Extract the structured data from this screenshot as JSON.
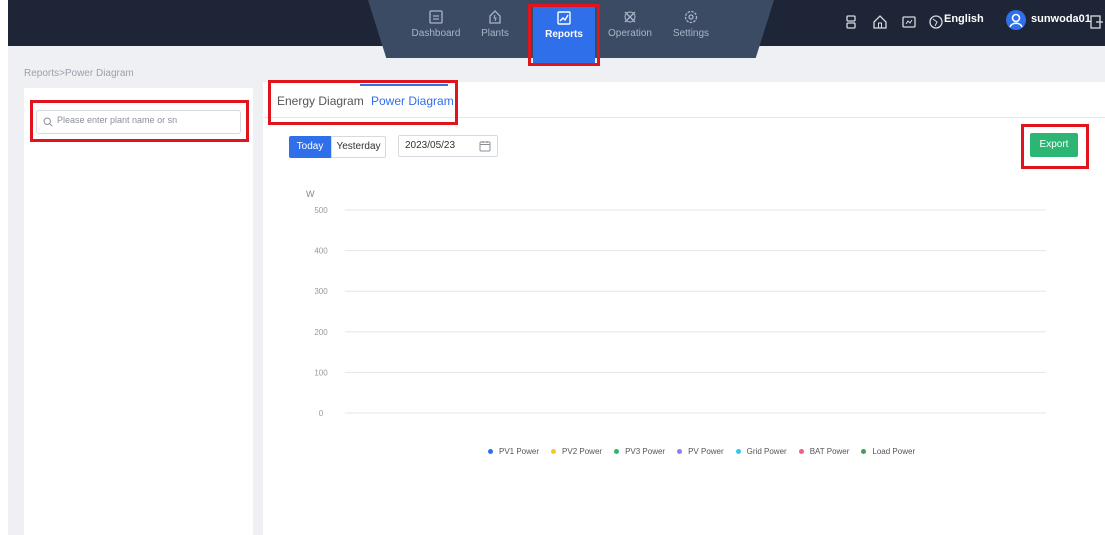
{
  "nav": {
    "items": [
      {
        "label": "Dashboard",
        "icon": "dashboard-icon",
        "active": false
      },
      {
        "label": "Plants",
        "icon": "plants-icon",
        "active": false
      },
      {
        "label": "Reports",
        "icon": "reports-icon",
        "active": true
      },
      {
        "label": "Operation",
        "icon": "operation-icon",
        "active": false
      },
      {
        "label": "Settings",
        "icon": "settings-icon",
        "active": false
      }
    ],
    "language": "English",
    "username": "sunwoda01"
  },
  "breadcrumb": "Reports>Power Diagram",
  "search": {
    "placeholder": "Please enter plant name or sn"
  },
  "tabs": [
    {
      "label": "Energy Diagram",
      "active": false
    },
    {
      "label": "Power Diagram",
      "active": true
    }
  ],
  "toolbar": {
    "today_label": "Today",
    "yesterday_label": "Yesterday",
    "date_value": "2023/05/23",
    "export_label": "Export"
  },
  "colors": {
    "accent": "#2f6fea",
    "export": "#2bb673",
    "highlight": "#e0141c",
    "topbar": "#1d2536"
  },
  "chart_data": {
    "type": "line",
    "ylabel": "W",
    "ylim": [
      0,
      500
    ],
    "yticks": [
      500,
      400,
      300,
      200,
      100,
      0
    ],
    "grid": true,
    "legend_position": "bottom",
    "series": [
      {
        "name": "PV1 Power",
        "color": "#2f6fea",
        "values": []
      },
      {
        "name": "PV2 Power",
        "color": "#f7c823",
        "values": []
      },
      {
        "name": "PV3 Power",
        "color": "#2bb673",
        "values": []
      },
      {
        "name": "PV Power",
        "color": "#8d7ff0",
        "values": []
      },
      {
        "name": "Grid Power",
        "color": "#35c8e6",
        "values": []
      },
      {
        "name": "BAT Power",
        "color": "#f06080",
        "values": []
      },
      {
        "name": "Load Power",
        "color": "#3aa05a",
        "values": []
      }
    ]
  }
}
